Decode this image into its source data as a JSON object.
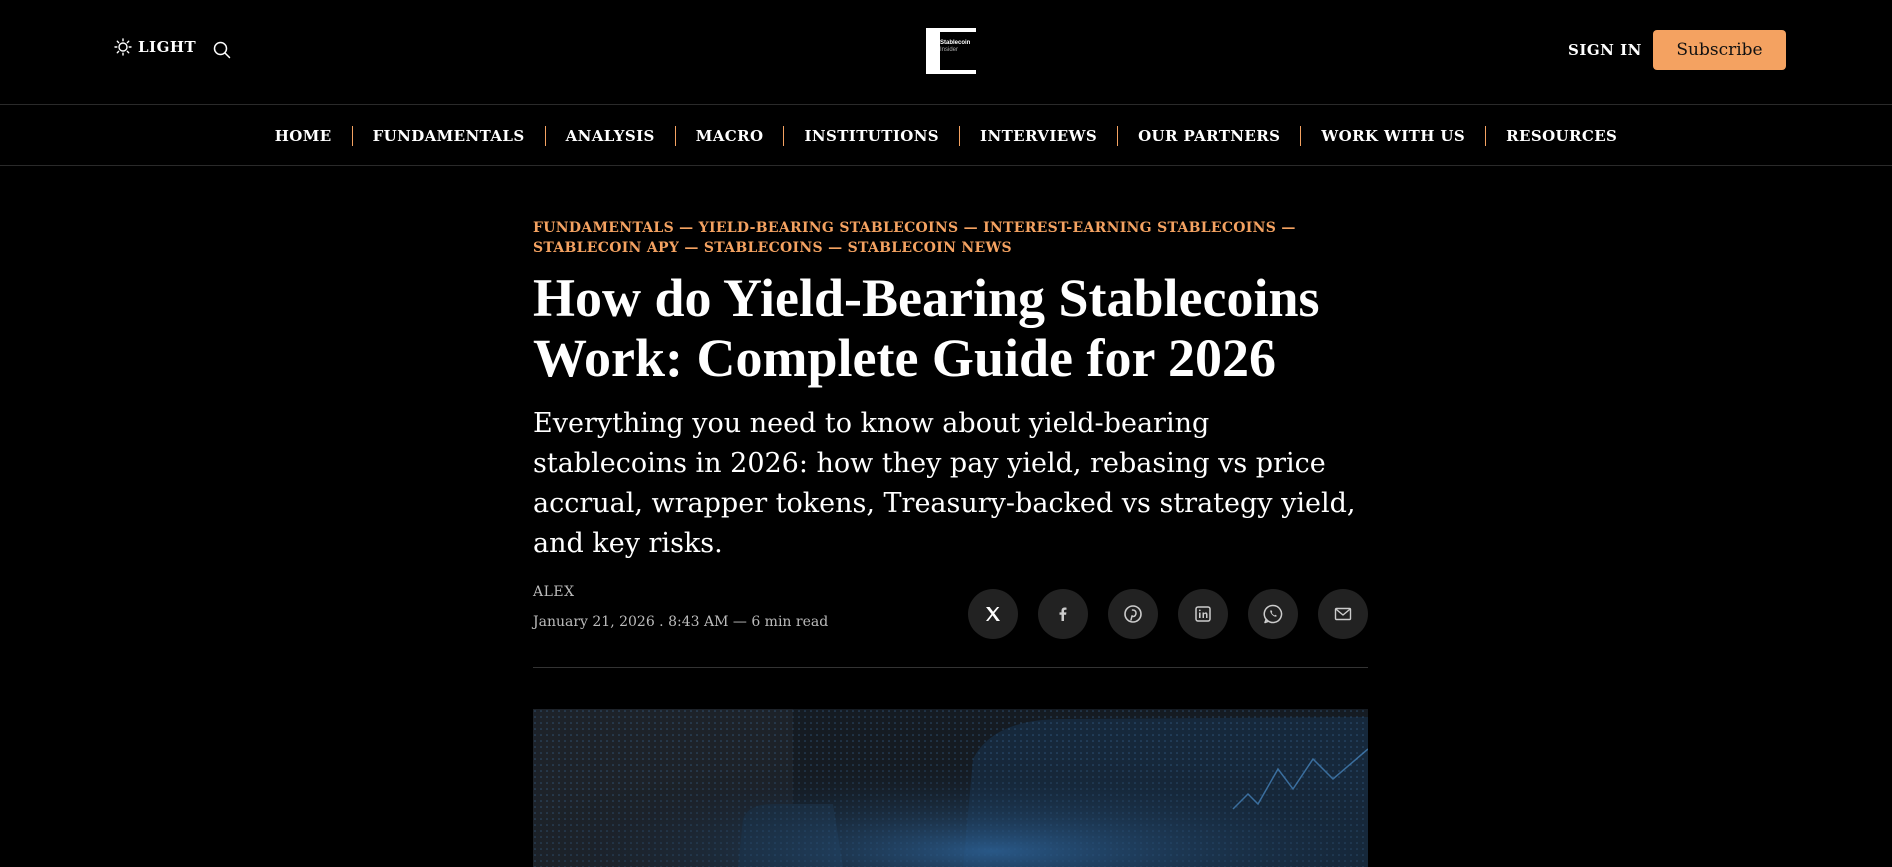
{
  "header": {
    "theme_toggle_label": "LIGHT",
    "sign_in_label": "SIGN IN",
    "subscribe_label": "Subscribe",
    "logo": {
      "line1": "Stablecoin",
      "line2": "Insider"
    }
  },
  "nav": {
    "items": [
      "HOME",
      "FUNDAMENTALS",
      "ANALYSIS",
      "MACRO",
      "INSTITUTIONS",
      "INTERVIEWS",
      "OUR PARTNERS",
      "WORK WITH US",
      "RESOURCES"
    ]
  },
  "article": {
    "tags": [
      "FUNDAMENTALS",
      "YIELD-BEARING STABLECOINS",
      "INTEREST-EARNING STABLECOINS",
      "STABLECOIN APY",
      "STABLECOINS",
      "STABLECOIN NEWS"
    ],
    "tag_separator": "—",
    "title_line1": "How do Yield-Bearing Stablecoins",
    "title_line2": "Work: Complete Guide for 2026",
    "subtitle": "Everything you need to know about yield-bearing stablecoins in 2026: how they pay yield, rebasing vs price accrual, wrapper tokens, Treasury-backed vs strategy yield, and key risks.",
    "author": "ALEX",
    "date_line": "January 21, 2026 . 8:43 AM — 6 min read"
  },
  "share": {
    "buttons": [
      "x-icon",
      "facebook-icon",
      "pinterest-icon",
      "linkedin-icon",
      "whatsapp-icon",
      "email-icon"
    ]
  },
  "colors": {
    "accent": "#f4a261",
    "background": "#000000",
    "share_bg": "#222222"
  }
}
